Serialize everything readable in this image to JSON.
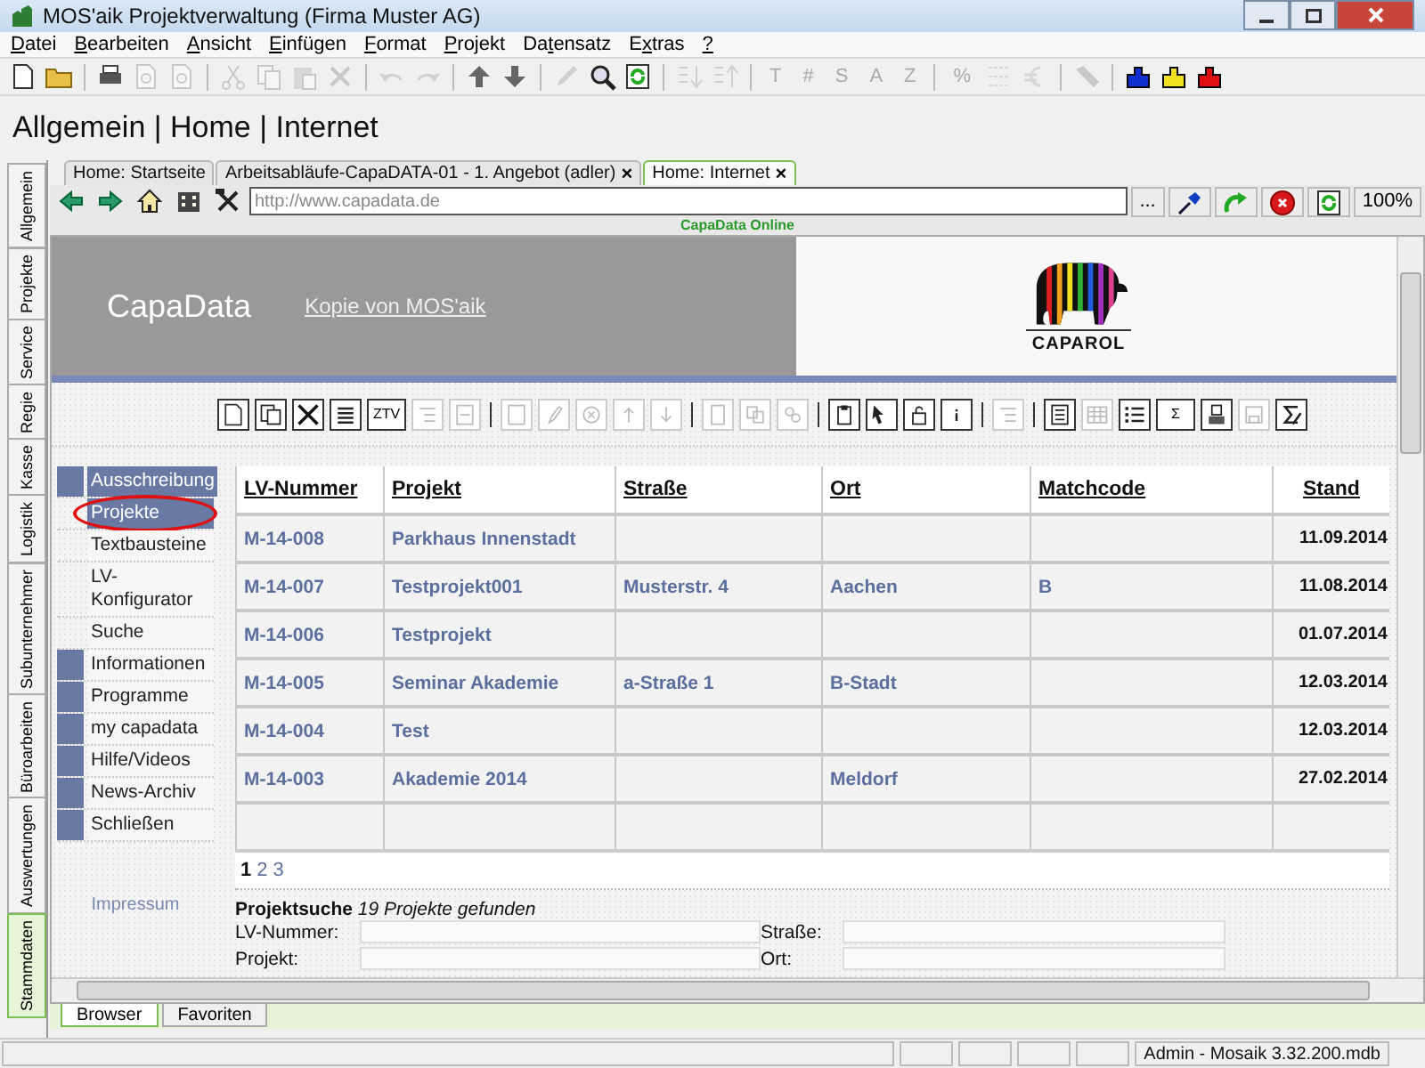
{
  "window": {
    "title": "MOS'aik Projektverwaltung (Firma Muster AG)"
  },
  "menu": [
    {
      "key": "D",
      "post": "atei"
    },
    {
      "key": "B",
      "post": "earbeiten"
    },
    {
      "key": "A",
      "post": "nsicht"
    },
    {
      "key": "E",
      "post": "infügen"
    },
    {
      "key": "F",
      "post": "ormat"
    },
    {
      "key": "P",
      "post": "rojekt"
    },
    {
      "pre": "Da",
      "key": "t",
      "post": "ensatz"
    },
    {
      "pre": "E",
      "key": "x",
      "post": "tras"
    },
    {
      "key": "?"
    }
  ],
  "toolbar": [
    {
      "kind": "icon",
      "disabled": false
    },
    {
      "kind": "icon",
      "disabled": false
    },
    {
      "kind": "separator"
    },
    {
      "kind": "icon",
      "disabled": false
    },
    {
      "kind": "icon",
      "disabled": true
    },
    {
      "kind": "icon",
      "disabled": true
    },
    {
      "kind": "separator"
    },
    {
      "kind": "icon",
      "disabled": true
    },
    {
      "kind": "icon",
      "disabled": true
    },
    {
      "kind": "icon",
      "disabled": true
    },
    {
      "kind": "icon",
      "disabled": true
    },
    {
      "kind": "separator"
    },
    {
      "kind": "icon",
      "disabled": true
    },
    {
      "kind": "icon",
      "disabled": true
    },
    {
      "kind": "separator"
    },
    {
      "kind": "icon",
      "disabled": false
    },
    {
      "kind": "icon",
      "disabled": false
    },
    {
      "kind": "separator"
    },
    {
      "kind": "icon",
      "disabled": true
    },
    {
      "kind": "icon",
      "disabled": false
    },
    {
      "kind": "icon",
      "disabled": false
    },
    {
      "kind": "separator"
    },
    {
      "kind": "icon",
      "disabled": true
    },
    {
      "kind": "icon",
      "disabled": true
    },
    {
      "kind": "separator"
    },
    {
      "kind": "text",
      "label": "T",
      "disabled": true
    },
    {
      "kind": "text",
      "label": "#",
      "disabled": true
    },
    {
      "kind": "text",
      "label": "S",
      "disabled": true
    },
    {
      "kind": "text",
      "label": "A",
      "disabled": true
    },
    {
      "kind": "text",
      "label": "Z",
      "disabled": true
    },
    {
      "kind": "separator"
    },
    {
      "kind": "text",
      "label": "%",
      "disabled": true
    },
    {
      "kind": "icon",
      "disabled": true
    },
    {
      "kind": "icon",
      "disabled": true
    },
    {
      "kind": "separator"
    },
    {
      "kind": "icon",
      "disabled": true
    },
    {
      "kind": "separator"
    },
    {
      "kind": "icon",
      "disabled": false
    },
    {
      "kind": "icon",
      "disabled": false
    },
    {
      "kind": "icon",
      "disabled": false
    }
  ],
  "breadcrumb": "Allgemein | Home | Internet",
  "side_tabs": [
    {
      "label": "Allgemein",
      "selected": false
    },
    {
      "label": "Projekte",
      "selected": false
    },
    {
      "label": "Service",
      "selected": false
    },
    {
      "label": "Regie",
      "selected": false
    },
    {
      "label": "Kasse",
      "selected": false
    },
    {
      "label": "Logistik",
      "selected": false
    },
    {
      "label": "Subunternehmer",
      "selected": false
    },
    {
      "label": "Büroarbeiten",
      "selected": false
    },
    {
      "label": "Auswertungen",
      "selected": false
    },
    {
      "label": "Stammdaten",
      "selected": true
    }
  ],
  "doc_tabs": [
    {
      "label": "Home: Startseite",
      "closable": false,
      "selected": false
    },
    {
      "label": "Arbeitsabläufe-CapaDATA-01 - 1. Angebot (adler)",
      "closable": true,
      "selected": false
    },
    {
      "label": "Home: Internet",
      "closable": true,
      "selected": true
    }
  ],
  "close_glyph": "×",
  "browser": {
    "url": "http://www.capadata.de",
    "more_button": "...",
    "zoom": "100%",
    "status_text": "CapaData Online"
  },
  "page": {
    "brand": "CapaData",
    "header_link": "Kopie von MOS'aik",
    "logo_text": "CAPAROL",
    "web_toolbar": [
      {
        "kind": "icon",
        "disabled": false
      },
      {
        "kind": "icon",
        "disabled": false
      },
      {
        "kind": "icon",
        "disabled": false
      },
      {
        "kind": "icon",
        "disabled": false
      },
      {
        "kind": "text",
        "label": "ZTV",
        "disabled": false
      },
      {
        "kind": "icon",
        "disabled": true
      },
      {
        "kind": "icon",
        "disabled": true
      },
      {
        "kind": "separator"
      },
      {
        "kind": "icon",
        "disabled": true
      },
      {
        "kind": "icon",
        "disabled": true
      },
      {
        "kind": "icon",
        "disabled": true
      },
      {
        "kind": "icon",
        "disabled": true
      },
      {
        "kind": "icon",
        "disabled": true
      },
      {
        "kind": "separator"
      },
      {
        "kind": "icon",
        "disabled": true
      },
      {
        "kind": "icon",
        "disabled": true
      },
      {
        "kind": "icon",
        "disabled": true
      },
      {
        "kind": "separator"
      },
      {
        "kind": "icon",
        "disabled": false
      },
      {
        "kind": "icon",
        "disabled": false
      },
      {
        "kind": "icon",
        "disabled": false
      },
      {
        "kind": "icon",
        "disabled": false
      },
      {
        "kind": "separator"
      },
      {
        "kind": "icon",
        "disabled": true
      },
      {
        "kind": "separator"
      },
      {
        "kind": "icon",
        "disabled": false
      },
      {
        "kind": "icon",
        "disabled": true
      },
      {
        "kind": "icon",
        "disabled": false
      },
      {
        "kind": "text",
        "label": "Σ",
        "disabled": false
      },
      {
        "kind": "icon",
        "disabled": false
      },
      {
        "kind": "icon",
        "disabled": true
      },
      {
        "kind": "icon",
        "disabled": false
      }
    ],
    "nav": [
      {
        "label": "Ausschreibung",
        "expanded": true,
        "children": [
          {
            "label": "Projekte",
            "selected": true,
            "circled": true
          },
          {
            "label": "Textbausteine",
            "selected": false,
            "circled": false
          },
          {
            "label": "LV-Konfigurator",
            "selected": false,
            "circled": false
          },
          {
            "label": "Suche",
            "selected": false,
            "circled": false
          }
        ]
      },
      {
        "label": "Informationen",
        "expanded": false
      },
      {
        "label": "Programme",
        "expanded": false
      },
      {
        "label": "my capadata",
        "expanded": false
      },
      {
        "label": "Hilfe/Videos",
        "expanded": false
      },
      {
        "label": "News-Archiv",
        "expanded": false
      },
      {
        "label": "Schließen",
        "expanded": false
      }
    ],
    "impressum": "Impressum",
    "table": {
      "columns": [
        "LV-Nummer",
        "Projekt",
        "Straße",
        "Ort",
        "Matchcode",
        "Stand"
      ],
      "rows": [
        {
          "lv_nummer": "M-14-008",
          "projekt": "Parkhaus Innenstadt",
          "stand": "11.09.2014"
        },
        {
          "lv_nummer": "M-14-007",
          "projekt": "Testprojekt001",
          "strasse": "Musterstr. 4",
          "ort": "Aachen",
          "matchcode": "B",
          "stand": "11.08.2014"
        },
        {
          "lv_nummer": "M-14-006",
          "projekt": "Testprojekt",
          "stand": "01.07.2014"
        },
        {
          "lv_nummer": "M-14-005",
          "projekt": "Seminar Akademie",
          "strasse": "a-Straße 1",
          "ort": "B-Stadt",
          "stand": "12.03.2014"
        },
        {
          "lv_nummer": "M-14-004",
          "projekt": "Test",
          "stand": "12.03.2014"
        },
        {
          "lv_nummer": "M-14-003",
          "projekt": "Akademie 2014",
          "ort": "Meldorf",
          "stand": "27.02.2014"
        }
      ]
    },
    "pages": [
      {
        "label": "1",
        "selected": true
      },
      {
        "label": "2",
        "selected": false
      },
      {
        "label": "3",
        "selected": false
      }
    ],
    "search": {
      "heading": "**Projektsuche** *19 Projekte gefunden*",
      "fields": [
        {
          "label": "LV-Nummer:"
        },
        {
          "label": "Straße:"
        },
        {
          "label": "Projekt:"
        },
        {
          "label": "Ort:"
        }
      ]
    }
  },
  "bottom_tabs": [
    {
      "label": "Browser",
      "selected": true
    },
    {
      "label": "Favoriten",
      "selected": false
    }
  ],
  "status_bar": {
    "info": "Admin - Mosaik 3.32.200.mdb"
  }
}
